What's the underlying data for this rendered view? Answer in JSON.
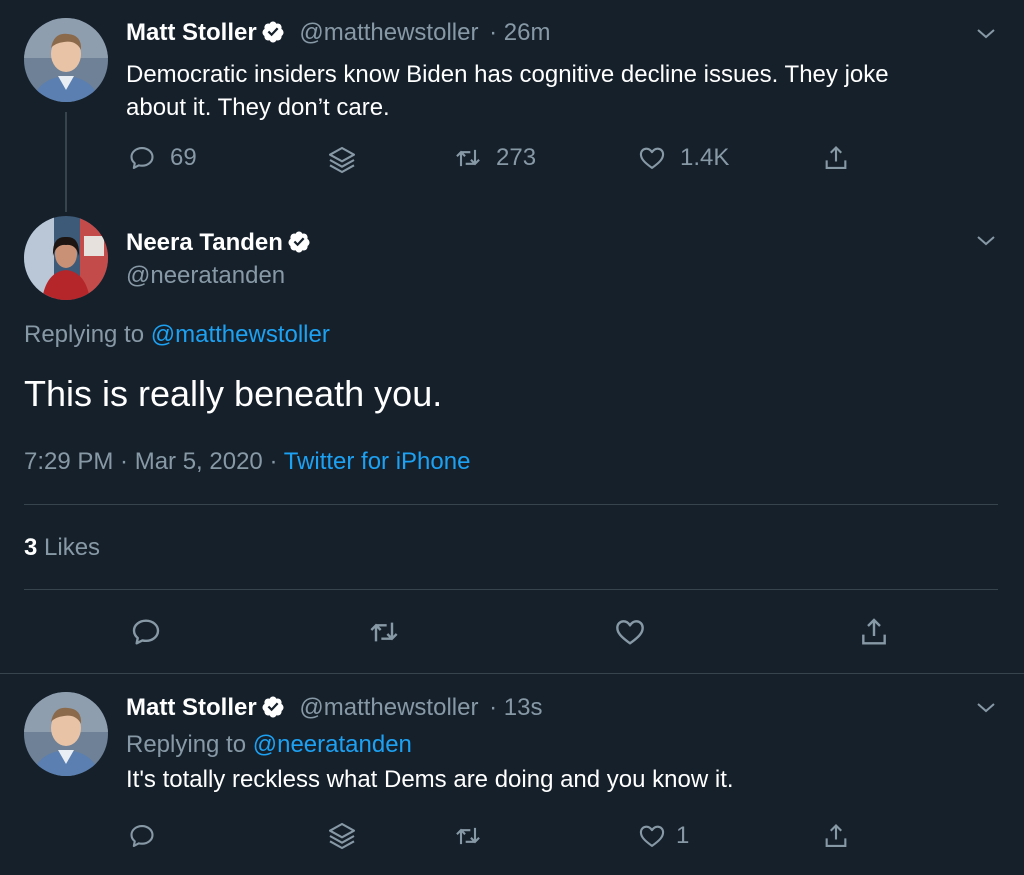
{
  "tweet1": {
    "name": "Matt Stoller",
    "handle": "@matthewstoller",
    "time": "· 26m",
    "text1": "Democratic insiders know Biden has cognitive decline issues. They joke",
    "text2": "about it. They don’t care.",
    "replies": "69",
    "retweets": "273",
    "likes": "1.4K"
  },
  "main": {
    "name": "Neera Tanden",
    "handle": "@neeratanden",
    "replying_prefix": "Replying to",
    "replying_to": "@matthewstoller",
    "text": "This is really beneath you.",
    "timestamp": "7:29 PM · Mar 5, 2020 ·",
    "source": "Twitter for iPhone",
    "likes_count": "3",
    "likes_label": "Likes"
  },
  "tweet3": {
    "name": "Matt Stoller",
    "handle": "@matthewstoller",
    "time": "· 13s",
    "replying_prefix": "Replying to",
    "replying_to": "@neeratanden",
    "text": "It's totally reckless what Dems are doing and you know it.",
    "likes": "1"
  },
  "colors": {
    "background": "#15202b",
    "muted": "#8899a6",
    "link": "#1da1f2",
    "divider": "#38444d"
  }
}
